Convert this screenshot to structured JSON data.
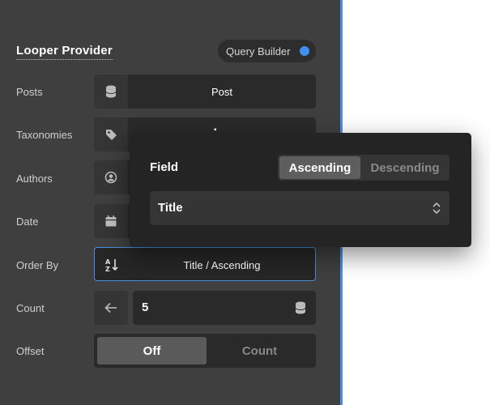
{
  "panel": {
    "title": "Looper Provider",
    "query_builder": {
      "label": "Query Builder",
      "enabled": true
    }
  },
  "rows": {
    "posts": {
      "label": "Posts",
      "icon": "database-icon",
      "value": "Post"
    },
    "taxonomies": {
      "label": "Taxonomies",
      "icon": "tag-icon",
      "value": ""
    },
    "authors": {
      "label": "Authors",
      "icon": "user-circle-icon",
      "value": ""
    },
    "date": {
      "label": "Date",
      "icon": "calendar-icon",
      "value": ""
    },
    "order_by": {
      "label": "Order By",
      "icon": "sort-alpha-icon",
      "value": "Title / Ascending"
    },
    "count": {
      "label": "Count",
      "icon": "arrow-left-icon",
      "value": "5"
    },
    "offset": {
      "label": "Offset",
      "options": [
        "Off",
        "Count"
      ],
      "selected": "Off"
    }
  },
  "popover": {
    "field_label": "Field",
    "direction_options": [
      "Ascending",
      "Descending"
    ],
    "direction_selected": "Ascending",
    "field_value": "Title"
  },
  "colors": {
    "panel_bg": "#3f3f3f",
    "accent": "#3f8ef0",
    "popover_bg": "#242424"
  }
}
